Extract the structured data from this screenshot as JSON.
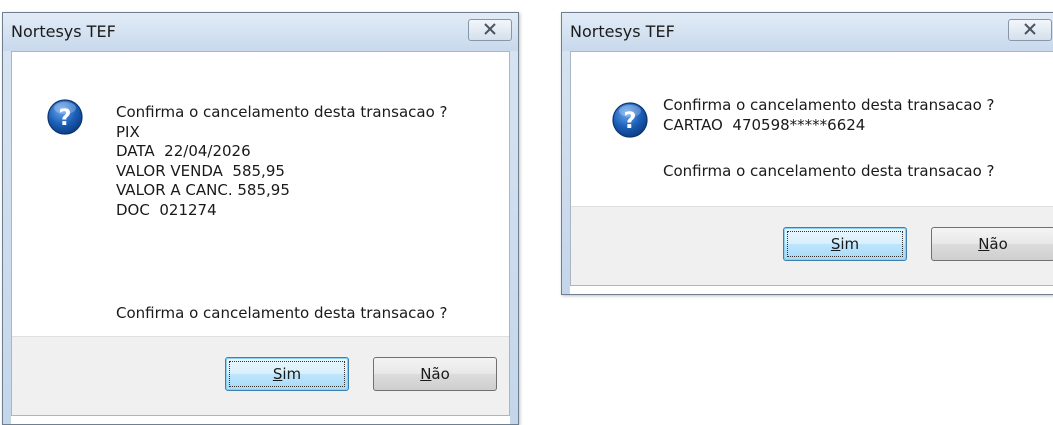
{
  "dialog_left": {
    "title": "Nortesys TEF",
    "lines": [
      "Confirma o cancelamento desta transacao ?",
      "PIX",
      "DATA  22/04/2026",
      "VALOR VENDA  585,95",
      "VALOR A CANC. 585,95",
      "DOC  021274"
    ],
    "confirm_question": "Confirma o cancelamento desta transacao ?",
    "yes_accel": "S",
    "yes_rest": "im",
    "no_accel": "N",
    "no_rest": "ão"
  },
  "dialog_right": {
    "title": "Nortesys TEF",
    "lines": [
      "Confirma o cancelamento desta transacao ?",
      "CARTAO  470598*****6624"
    ],
    "confirm_question": "Confirma o cancelamento desta transacao ?",
    "yes_accel": "S",
    "yes_rest": "im",
    "no_accel": "N",
    "no_rest": "ão"
  },
  "icons": {
    "question": "question-icon",
    "close": "close-icon"
  },
  "colors": {
    "titlebar": "#c8d9ec",
    "default_button_border": "#3c7fb1",
    "icon_blue": "#1c5fb8"
  }
}
